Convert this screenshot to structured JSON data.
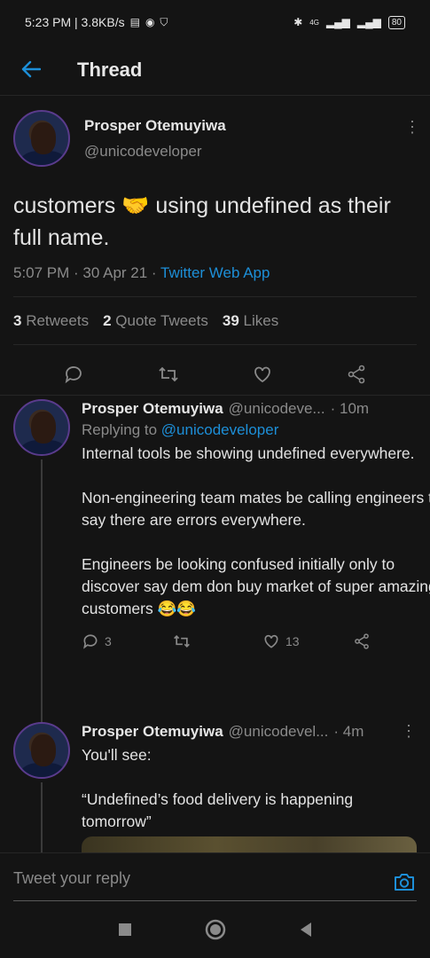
{
  "status_bar": {
    "time_speed": "5:23 PM | 3.8KB/s",
    "network": "4G",
    "battery": "80"
  },
  "header": {
    "title": "Thread"
  },
  "main_tweet": {
    "author_name": "Prosper Otemuyiwa",
    "author_handle": "@unicodeveloper",
    "text": "customers 🤝 using undefined as their full name.",
    "time_date": "5:07 PM · 30 Apr 21 · ",
    "source": "Twitter Web App",
    "retweets_count": "3",
    "retweets_label": "Retweets",
    "quotes_count": "2",
    "quotes_label": "Quote Tweets",
    "likes_count": "39",
    "likes_label": "Likes"
  },
  "replies": [
    {
      "author_name": "Prosper Otemuyiwa",
      "author_handle": "@unicodeve...",
      "time": "· 10m",
      "replying_label": "Replying to",
      "replying_handle": "@unicodeveloper",
      "text": "Internal tools be showing undefined everywhere.\n\nNon-engineering team mates be calling engineers to say there are errors everywhere.\n\nEngineers be looking confused initially only to discover say dem don buy market of super amazing customers 😂😂",
      "reply_count": "3",
      "retweet_count": "",
      "like_count": "13"
    },
    {
      "author_name": "Prosper Otemuyiwa",
      "author_handle": "@unicodevel...",
      "time": "· 4m",
      "text": "You'll see:\n\n“Undefined’s food delivery is happening tomorrow”"
    }
  ],
  "composer": {
    "placeholder": "Tweet your reply"
  }
}
